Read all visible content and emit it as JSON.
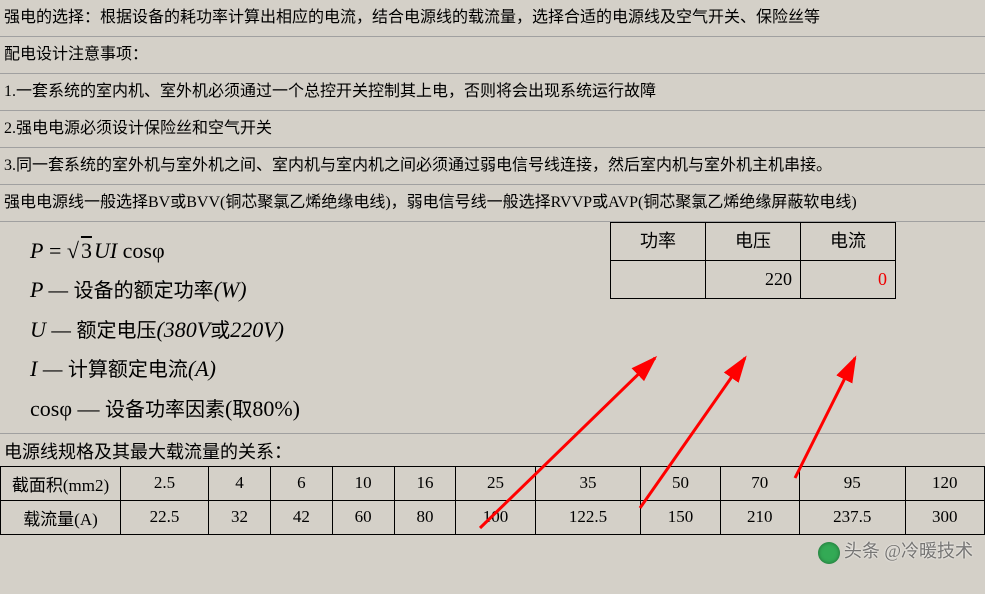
{
  "paragraphs": {
    "p1": "强电的选择：根据设备的耗功率计算出相应的电流，结合电源线的载流量，选择合适的电源线及空气开关、保险丝等",
    "p2": "配电设计注意事项：",
    "p3": "1.一套系统的室内机、室外机必须通过一个总控开关控制其上电，否则将会出现系统运行故障",
    "p4": "2.强电电源必须设计保险丝和空气开关",
    "p5": "3.同一套系统的室外机与室外机之间、室内机与室内机之间必须通过弱电信号线连接，然后室内机与室外机主机串接。",
    "p6": "强电电源线一般选择BV或BVV(铜芯聚氯乙烯绝缘电线)，弱电信号线一般选择RVVP或AVP(铜芯聚氯乙烯绝缘屏蔽软电线)"
  },
  "formula": {
    "eq": {
      "lhs": "P",
      "eq": " = ",
      "sqrt": "3",
      "rest": "UI",
      "cos": " cos",
      "phi": "φ"
    },
    "l2_a": "P — ",
    "l2_b": "设备的额定功率",
    "l2_c": "(W)",
    "l3_a": "U — ",
    "l3_b": "额定电压",
    "l3_c": "(380V",
    "l3_d": "或",
    "l3_e": "220V)",
    "l4_a": "I — ",
    "l4_b": "计算额定电流",
    "l4_c": "(A)",
    "l5_a": "cos",
    "l5_b": "φ — ",
    "l5_c": "设备功率因素",
    "l5_d": "(",
    "l5_e": "取",
    "l5_f": "80%)"
  },
  "mini_table": {
    "headers": [
      "功率",
      "电压",
      "电流"
    ],
    "values": [
      "",
      "220",
      "0"
    ]
  },
  "caption": "电源线规格及其最大载流量的关系：",
  "chart_data": {
    "type": "table",
    "title": "电源线规格及其最大载流量的关系",
    "row_labels": [
      "截面积(mm2)",
      "载流量(A)"
    ],
    "columns": [
      "2.5",
      "4",
      "6",
      "10",
      "16",
      "25",
      "35",
      "50",
      "70",
      "95",
      "120"
    ],
    "series": [
      {
        "name": "截面积(mm2)",
        "values": [
          2.5,
          4,
          6,
          10,
          16,
          25,
          35,
          50,
          70,
          95,
          120
        ]
      },
      {
        "name": "载流量(A)",
        "values": [
          22.5,
          32,
          42,
          60,
          80,
          100,
          122.5,
          150,
          210,
          237.5,
          300
        ]
      }
    ]
  },
  "watermark": "头条 @冷暖技术"
}
